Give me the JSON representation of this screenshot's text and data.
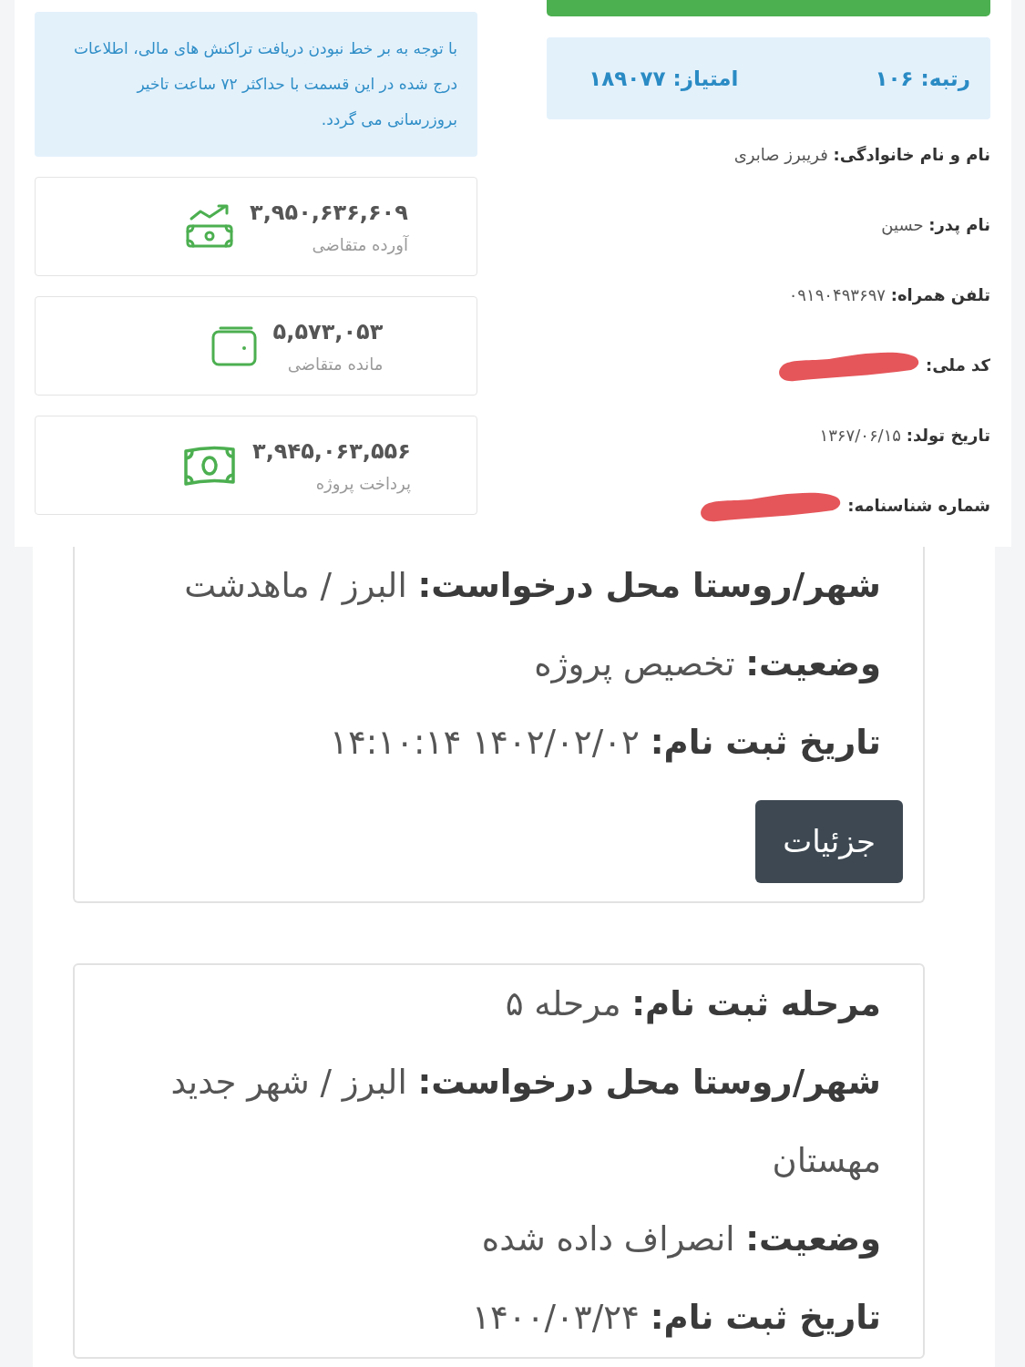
{
  "top_panel": {
    "notice": "با توجه به بر خط نبودن دریافت تراکنش های مالی، اطلاعات درج شده در این قسمت با حداکثر ۷۲ ساعت تاخیر بروزرسانی می گردد.",
    "stats": [
      {
        "kind": "income",
        "value": "۳,۹۵۰,۶۳۶,۶۰۹",
        "label": "آورده متقاضی"
      },
      {
        "kind": "wallet",
        "value": "۵,۵۷۳,۰۵۳",
        "label": "مانده متقاضی"
      },
      {
        "kind": "payment",
        "value": "۳,۹۴۵,۰۶۳,۵۵۶",
        "label": "پرداخت پروژه"
      }
    ],
    "rank": {
      "label": "رتبه:",
      "value": "۱۰۶"
    },
    "score": {
      "label": "امتیاز:",
      "value": "۱۸۹۰۷۷"
    },
    "profile": [
      {
        "label": "نام و نام خانوادگی:",
        "value": "فریبرز صابری",
        "redacted": false
      },
      {
        "label": "نام پدر:",
        "value": "حسین",
        "redacted": false
      },
      {
        "label": "تلفن همراه:",
        "value": "۰۹۱۹۰۴۹۳۶۹۷",
        "redacted": false
      },
      {
        "label": "کد ملی:",
        "redacted": true
      },
      {
        "label": "تاریخ تولد:",
        "value": "۱۳۶۷/۰۶/۱۵",
        "redacted": false
      },
      {
        "label": "شماره شناسنامه:",
        "redacted": true
      }
    ]
  },
  "requests": [
    {
      "fields": [
        {
          "label": "شهر/روستا محل درخواست:",
          "value": "البرز / ماهدشت"
        },
        {
          "label": "وضعیت:",
          "value": "تخصیص پروژه"
        },
        {
          "label": "تاریخ ثبت نام:",
          "value": "۱۴۰۲/۰۲/۰۲ ۱۴:۱۰:۱۴"
        }
      ],
      "button": "جزئیات"
    },
    {
      "fields": [
        {
          "label": "مرحله ثبت نام:",
          "value": "مرحله ۵"
        },
        {
          "label": "شهر/روستا محل درخواست:",
          "value": "البرز / شهر جدید مهستان"
        },
        {
          "label": "وضعیت:",
          "value": "انصراف داده شده"
        },
        {
          "label": "تاریخ ثبت نام:",
          "value": "۱۴۰۰/۰۳/۲۴"
        }
      ]
    }
  ]
}
